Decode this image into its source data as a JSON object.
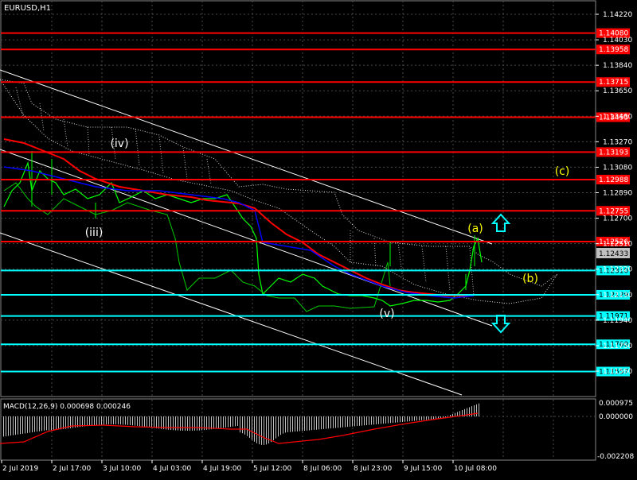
{
  "header": {
    "symbol_label": "EURUSD,H1"
  },
  "indicator": {
    "label": "MACD(12,26,9) 0.000698 0.000246",
    "ticks": [
      "0.000975",
      "0.000000",
      "-0.002208"
    ]
  },
  "price_ticks": [
    "1.14220",
    "1.14030",
    "1.13840",
    "1.13650",
    "1.13460",
    "1.13270",
    "1.13080",
    "1.12890",
    "1.12700",
    "1.12510",
    "1.12320",
    "1.12130",
    "1.11940",
    "1.11750",
    "1.11560"
  ],
  "current_price": "1.12433",
  "time_labels": [
    "2 Jul 2019",
    "2 Jul 17:00",
    "3 Jul 10:00",
    "4 Jul 03:00",
    "4 Jul 19:00",
    "5 Jul 12:00",
    "8 Jul 06:00",
    "8 Jul 23:00",
    "9 Jul 15:00",
    "10 Jul 08:00"
  ],
  "resistance_levels": [
    {
      "label": "1.14080",
      "price": 1.1408
    },
    {
      "label": "1.13958",
      "price": 1.13958
    },
    {
      "label": "1.13715",
      "price": 1.13715
    },
    {
      "label": "1.13453",
      "price": 1.13453
    },
    {
      "label": "1.13193",
      "price": 1.13193
    },
    {
      "label": "1.12988",
      "price": 1.12988
    },
    {
      "label": "1.12755",
      "price": 1.12755
    },
    {
      "label": "1.12526",
      "price": 1.12526
    }
  ],
  "support_levels": [
    {
      "label": "1.12310",
      "price": 1.1231
    },
    {
      "label": "1.12129",
      "price": 1.12129
    },
    {
      "label": "1.11971",
      "price": 1.11971
    },
    {
      "label": "1.11760",
      "price": 1.1176
    },
    {
      "label": "1.11557",
      "price": 1.11557
    }
  ],
  "wave_labels": {
    "iv": "(iv)",
    "iii": "(iii)",
    "v": "(v)",
    "a": "(a)",
    "b": "(b)",
    "c": "(c)"
  },
  "colors": {
    "resistance": "#ff0000",
    "support": "#00ffff",
    "candles": "#00ff00",
    "ma_red": "#ff0000",
    "ma_blue": "#0000ff",
    "wave_white": "#ffffff",
    "wave_yellow": "#ffff00",
    "arrows": "#00ffff"
  },
  "icons": {
    "up_arrow": "arrow-up-outline-icon",
    "down_arrow": "arrow-down-outline-icon"
  }
}
